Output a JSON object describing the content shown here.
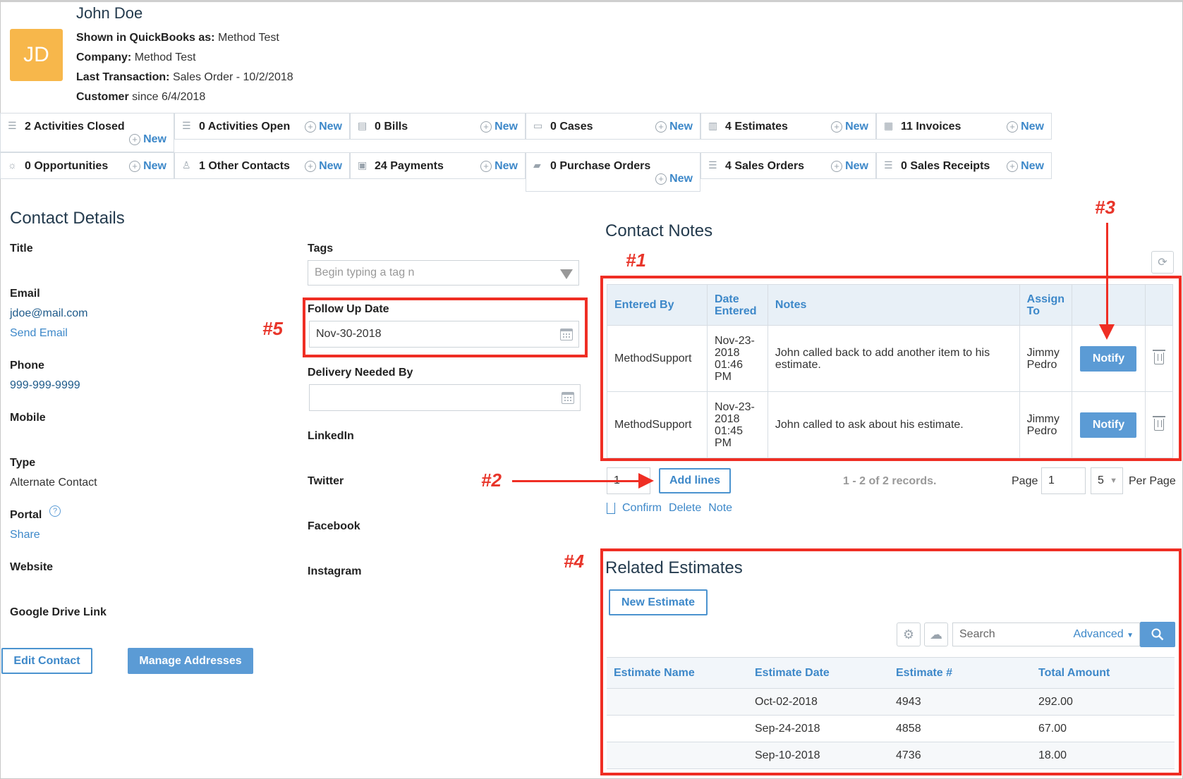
{
  "contact": {
    "initials": "JD",
    "name": "John Doe",
    "shown_label": "Shown in QuickBooks as:",
    "shown_value": "Method Test",
    "company_label": "Company:",
    "company_value": "Method Test",
    "last_txn_label": "Last Transaction:",
    "last_txn_value": "Sales Order - 10/2/2018",
    "customer_label": "Customer",
    "customer_value": "since 6/4/2018"
  },
  "activities": [
    {
      "label": "2 Activities Closed",
      "new": "New",
      "icon": "list-icon"
    },
    {
      "label": "0 Activities Open",
      "new": "New",
      "icon": "list-icon"
    },
    {
      "label": "0 Bills",
      "new": "New",
      "icon": "bill-icon"
    },
    {
      "label": "0 Cases",
      "new": "New",
      "icon": "inbox-icon"
    },
    {
      "label": "4 Estimates",
      "new": "New",
      "icon": "estimate-icon"
    },
    {
      "label": "11 Invoices",
      "new": "New",
      "icon": "invoice-icon"
    },
    {
      "label": "0 Opportunities",
      "new": "New",
      "icon": "lightbulb-icon"
    },
    {
      "label": "1 Other Contacts",
      "new": "New",
      "icon": "contacts-icon"
    },
    {
      "label": "24 Payments",
      "new": "New",
      "icon": "payment-icon"
    },
    {
      "label": "0 Purchase Orders",
      "new": "New",
      "icon": "cart-icon"
    },
    {
      "label": "4 Sales Orders",
      "new": "New",
      "icon": "list-icon"
    },
    {
      "label": "0 Sales Receipts",
      "new": "New",
      "icon": "list-icon"
    }
  ],
  "details": {
    "heading": "Contact Details",
    "title_label": "Title",
    "email_label": "Email",
    "email_value": "jdoe@mail.com",
    "send_email": "Send Email",
    "phone_label": "Phone",
    "phone_value": "999-999-9999",
    "mobile_label": "Mobile",
    "type_label": "Type",
    "type_value": "Alternate Contact",
    "portal_label": "Portal",
    "portal_share": "Share",
    "website_label": "Website",
    "gdrive_label": "Google Drive Link",
    "edit_contact": "Edit Contact",
    "manage_addresses": "Manage Addresses"
  },
  "extra": {
    "tags_label": "Tags",
    "tags_placeholder": "Begin typing a tag n",
    "followup_label": "Follow Up Date",
    "followup_value": "Nov-30-2018",
    "delivery_label": "Delivery Needed By",
    "delivery_value": "",
    "linkedin_label": "LinkedIn",
    "twitter_label": "Twitter",
    "facebook_label": "Facebook",
    "instagram_label": "Instagram"
  },
  "notes": {
    "heading": "Contact Notes",
    "columns": [
      "Entered By",
      "Date Entered",
      "Notes",
      "Assign To"
    ],
    "rows": [
      {
        "entered_by": "MethodSupport",
        "date": "Nov-23-2018 01:46 PM",
        "note": "John called back to add another item to his estimate.",
        "assign": "Jimmy Pedro",
        "notify": "Notify"
      },
      {
        "entered_by": "MethodSupport",
        "date": "Nov-23-2018 01:45 PM",
        "note": "John called to ask about his estimate.",
        "assign": "Jimmy Pedro",
        "notify": "Notify"
      }
    ],
    "lines_value": "1",
    "add_lines": "Add lines",
    "records": "1 - 2 of 2 records.",
    "page_label": "Page",
    "page_value": "1",
    "per_page_value": "5",
    "per_page_label": "Per Page",
    "confirm": "Confirm",
    "delete": "Delete",
    "note": "Note"
  },
  "estimates": {
    "heading": "Related Estimates",
    "new_estimate": "New Estimate",
    "search_placeholder": "Search",
    "advanced": "Advanced",
    "columns": [
      "Estimate Name",
      "Estimate Date",
      "Estimate #",
      "Total Amount"
    ],
    "rows": [
      {
        "name": "",
        "date": "Oct-02-2018",
        "number": "4943",
        "amount": "292.00"
      },
      {
        "name": "",
        "date": "Sep-24-2018",
        "number": "4858",
        "amount": "67.00"
      },
      {
        "name": "",
        "date": "Sep-10-2018",
        "number": "4736",
        "amount": "18.00"
      }
    ]
  },
  "annotations": {
    "a1": "#1",
    "a2": "#2",
    "a3": "#3",
    "a4": "#4",
    "a5": "#5"
  }
}
